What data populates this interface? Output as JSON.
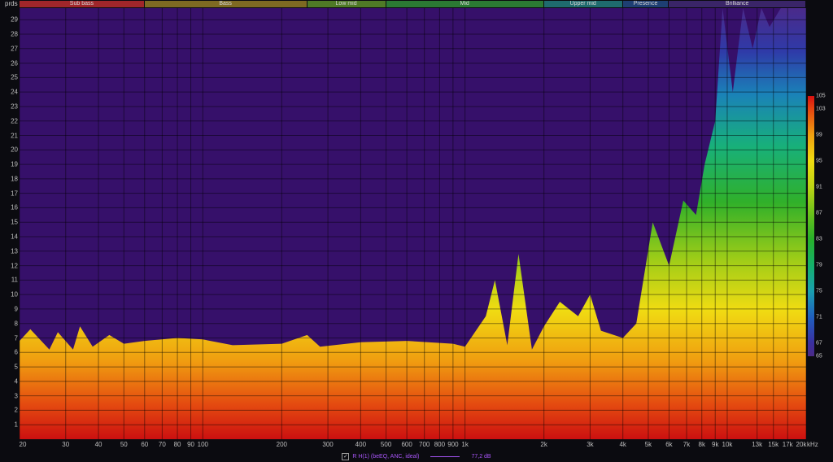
{
  "y_unit_label": "prds",
  "x_unit_label": "kHz",
  "bands": [
    {
      "name": "Sub bass",
      "from": 20,
      "to": 60,
      "color": "#a0262a"
    },
    {
      "name": "Bass",
      "from": 60,
      "to": 250,
      "color": "#7e6a22"
    },
    {
      "name": "Low mid",
      "from": 250,
      "to": 500,
      "color": "#4f7a26"
    },
    {
      "name": "Mid",
      "from": 500,
      "to": 2000,
      "color": "#2b7a33"
    },
    {
      "name": "Upper mid",
      "from": 2000,
      "to": 4000,
      "color": "#1f6b6e"
    },
    {
      "name": "Presence",
      "from": 4000,
      "to": 6000,
      "color": "#1e3f73"
    },
    {
      "name": "Brilliance",
      "from": 6000,
      "to": 20000,
      "color": "#3a2568"
    }
  ],
  "legend": {
    "checked": "✓",
    "label": "R H(1) (beEQ, ANC, ideal)",
    "value": "77,2 dB",
    "color": "#a855f7"
  },
  "chart_data": {
    "type": "heatmap",
    "title": "",
    "x_scale": "log",
    "xlim": [
      20,
      20000
    ],
    "ylim": [
      0,
      29.8
    ],
    "x_ticks": [
      {
        "v": 20,
        "label": "20"
      },
      {
        "v": 30,
        "label": "30"
      },
      {
        "v": 40,
        "label": "40"
      },
      {
        "v": 50,
        "label": "50"
      },
      {
        "v": 60,
        "label": "60"
      },
      {
        "v": 70,
        "label": "70"
      },
      {
        "v": 80,
        "label": "80"
      },
      {
        "v": 90,
        "label": "90"
      },
      {
        "v": 100,
        "label": "100"
      },
      {
        "v": 200,
        "label": "200"
      },
      {
        "v": 300,
        "label": "300"
      },
      {
        "v": 400,
        "label": "400"
      },
      {
        "v": 500,
        "label": "500"
      },
      {
        "v": 600,
        "label": "600"
      },
      {
        "v": 700,
        "label": "700"
      },
      {
        "v": 800,
        "label": "800"
      },
      {
        "v": 900,
        "label": "900"
      },
      {
        "v": 1000,
        "label": "1k"
      },
      {
        "v": 2000,
        "label": "2k"
      },
      {
        "v": 3000,
        "label": "3k"
      },
      {
        "v": 4000,
        "label": "4k"
      },
      {
        "v": 5000,
        "label": "5k"
      },
      {
        "v": 6000,
        "label": "6k"
      },
      {
        "v": 7000,
        "label": "7k"
      },
      {
        "v": 8000,
        "label": "8k"
      },
      {
        "v": 9000,
        "label": "9k"
      },
      {
        "v": 10000,
        "label": "10k"
      },
      {
        "v": 13000,
        "label": "13k"
      },
      {
        "v": 15000,
        "label": "15k"
      },
      {
        "v": 17000,
        "label": "17k"
      },
      {
        "v": 20000,
        "label": "20k"
      }
    ],
    "y_ticks": [
      1,
      2,
      3,
      4,
      5,
      6,
      7,
      8,
      9,
      10,
      11,
      12,
      13,
      14,
      15,
      16,
      17,
      18,
      19,
      20,
      21,
      22,
      23,
      24,
      25,
      26,
      27,
      28,
      29
    ],
    "color_scale": {
      "min": 65,
      "max": 105,
      "ticks": [
        "105",
        "103",
        "99",
        "95",
        "91",
        "87",
        "83",
        "79",
        "75",
        "71",
        "67",
        "65"
      ],
      "stops": [
        {
          "v": 65,
          "color": "#4b2a86"
        },
        {
          "v": 67,
          "color": "#3a2fa0"
        },
        {
          "v": 71,
          "color": "#1f5fbf"
        },
        {
          "v": 75,
          "color": "#1aa0b0"
        },
        {
          "v": 79,
          "color": "#14b06a"
        },
        {
          "v": 83,
          "color": "#28b02a"
        },
        {
          "v": 87,
          "color": "#6cc21a"
        },
        {
          "v": 91,
          "color": "#bcd414"
        },
        {
          "v": 95,
          "color": "#f0dc10"
        },
        {
          "v": 99,
          "color": "#f0a010"
        },
        {
          "v": 103,
          "color": "#e64510"
        },
        {
          "v": 105,
          "color": "#d81010"
        }
      ]
    },
    "background_color": "#36106a",
    "decay_envelope": [
      {
        "f": 20,
        "y": 6.8
      },
      {
        "f": 22,
        "y": 7.6
      },
      {
        "f": 26,
        "y": 6.2
      },
      {
        "f": 28,
        "y": 7.4
      },
      {
        "f": 32,
        "y": 6.2
      },
      {
        "f": 34,
        "y": 7.8
      },
      {
        "f": 38,
        "y": 6.4
      },
      {
        "f": 44,
        "y": 7.2
      },
      {
        "f": 50,
        "y": 6.6
      },
      {
        "f": 60,
        "y": 6.8
      },
      {
        "f": 80,
        "y": 7.0
      },
      {
        "f": 100,
        "y": 6.9
      },
      {
        "f": 130,
        "y": 6.5
      },
      {
        "f": 200,
        "y": 6.6
      },
      {
        "f": 250,
        "y": 7.2
      },
      {
        "f": 280,
        "y": 6.4
      },
      {
        "f": 400,
        "y": 6.7
      },
      {
        "f": 600,
        "y": 6.8
      },
      {
        "f": 900,
        "y": 6.6
      },
      {
        "f": 1000,
        "y": 6.4
      },
      {
        "f": 1200,
        "y": 8.5
      },
      {
        "f": 1300,
        "y": 11.0
      },
      {
        "f": 1450,
        "y": 6.5
      },
      {
        "f": 1600,
        "y": 12.8
      },
      {
        "f": 1800,
        "y": 6.2
      },
      {
        "f": 2000,
        "y": 7.8
      },
      {
        "f": 2300,
        "y": 9.5
      },
      {
        "f": 2700,
        "y": 8.5
      },
      {
        "f": 3000,
        "y": 10.0
      },
      {
        "f": 3300,
        "y": 7.5
      },
      {
        "f": 4000,
        "y": 7.0
      },
      {
        "f": 4500,
        "y": 8.0
      },
      {
        "f": 5200,
        "y": 15.0
      },
      {
        "f": 6000,
        "y": 12.0
      },
      {
        "f": 6800,
        "y": 16.5
      },
      {
        "f": 7600,
        "y": 15.5
      },
      {
        "f": 8200,
        "y": 19.0
      },
      {
        "f": 9000,
        "y": 22.0
      },
      {
        "f": 9600,
        "y": 29.8
      },
      {
        "f": 10500,
        "y": 24.0
      },
      {
        "f": 11500,
        "y": 29.8
      },
      {
        "f": 12500,
        "y": 27.0
      },
      {
        "f": 13500,
        "y": 29.8
      },
      {
        "f": 14500,
        "y": 28.5
      },
      {
        "f": 16000,
        "y": 29.8
      },
      {
        "f": 18000,
        "y": 29.8
      },
      {
        "f": 20000,
        "y": 29.8
      }
    ]
  }
}
